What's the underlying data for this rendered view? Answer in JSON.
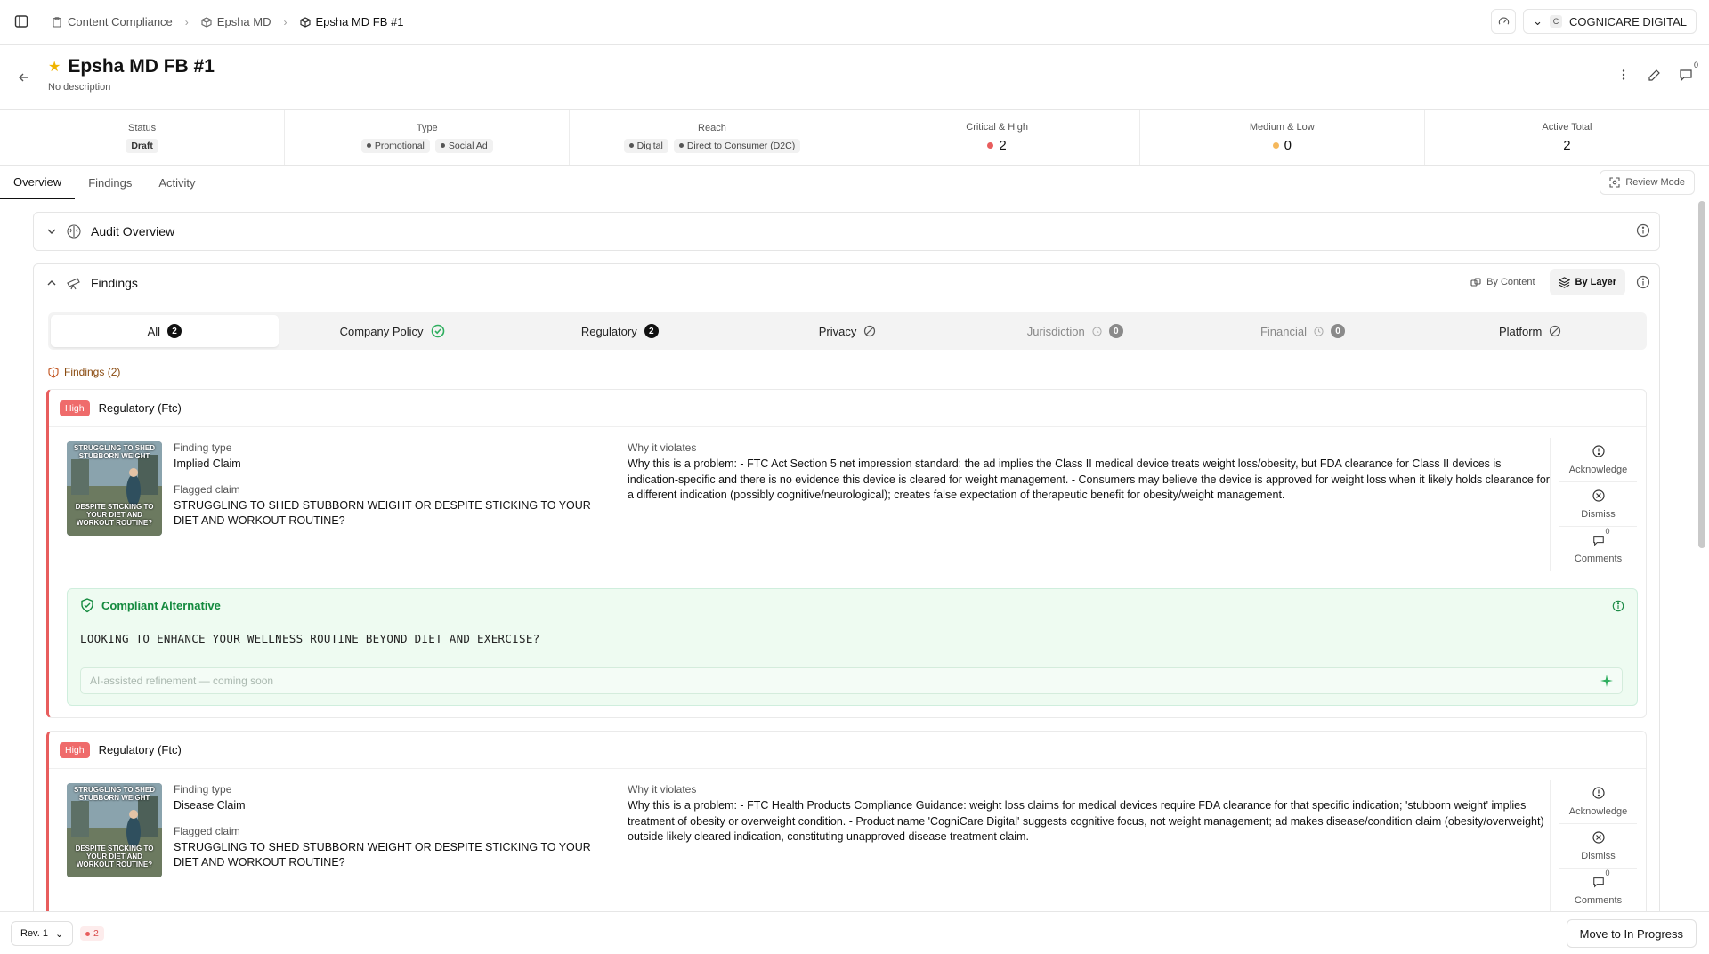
{
  "breadcrumbs": [
    "Content Compliance",
    "Epsha MD",
    "Epsha MD FB #1"
  ],
  "org": {
    "initial": "C",
    "name": "COGNICARE DIGITAL"
  },
  "header": {
    "title": "Epsha MD FB #1",
    "description": "No description",
    "comment_count": "0"
  },
  "stats": {
    "status": {
      "label": "Status",
      "value": "Draft"
    },
    "type": {
      "label": "Type",
      "values": [
        "Promotional",
        "Social Ad"
      ]
    },
    "reach": {
      "label": "Reach",
      "values": [
        "Digital",
        "Direct to Consumer (D2C)"
      ]
    },
    "critical_high": {
      "label": "Critical & High",
      "value": "2"
    },
    "medium_low": {
      "label": "Medium & Low",
      "value": "0"
    },
    "active_total": {
      "label": "Active Total",
      "value": "2"
    }
  },
  "tabs": [
    "Overview",
    "Findings",
    "Activity"
  ],
  "review_mode": "Review Mode",
  "audit_overview": {
    "title": "Audit Overview"
  },
  "findings_panel": {
    "title": "Findings",
    "by_content": "By Content",
    "by_layer": "By Layer",
    "layers": [
      {
        "label": "All",
        "count": "2"
      },
      {
        "label": "Company Policy"
      },
      {
        "label": "Regulatory",
        "count": "2"
      },
      {
        "label": "Privacy"
      },
      {
        "label": "Jurisdiction",
        "count": "0"
      },
      {
        "label": "Financial",
        "count": "0"
      },
      {
        "label": "Platform"
      }
    ],
    "findings_count": "Findings (2)"
  },
  "thumbnail": {
    "line1": "STRUGGLING TO SHED STUBBORN WEIGHT",
    "line2": "DESPITE STICKING TO YOUR DIET AND WORKOUT ROUTINE?"
  },
  "findings": [
    {
      "severity": "High",
      "category": "Regulatory (Ftc)",
      "finding_type_label": "Finding type",
      "finding_type": "Implied Claim",
      "flagged_label": "Flagged claim",
      "flagged": "STRUGGLING TO SHED STUBBORN WEIGHT OR DESPITE STICKING TO YOUR DIET AND WORKOUT ROUTINE?",
      "why_label": "Why it violates",
      "why": "Why this is a problem: - FTC Act Section 5 net impression standard: the ad implies the Class II medical device treats weight loss/obesity, but FDA clearance for Class II devices is indication-specific and there is no evidence this device is cleared for weight management. - Consumers may believe the device is approved for weight loss when it likely holds clearance for a different indication (possibly cognitive/neurological); creates false expectation of therapeutic benefit for obesity/weight management.",
      "actions": {
        "acknowledge": "Acknowledge",
        "dismiss": "Dismiss",
        "comments": "Comments",
        "comment_count": "0"
      },
      "alternative": {
        "title": "Compliant Alternative",
        "text": "LOOKING TO ENHANCE YOUR WELLNESS ROUTINE BEYOND DIET AND EXERCISE?",
        "placeholder": "AI-assisted refinement — coming soon"
      }
    },
    {
      "severity": "High",
      "category": "Regulatory (Ftc)",
      "finding_type_label": "Finding type",
      "finding_type": "Disease Claim",
      "flagged_label": "Flagged claim",
      "flagged": "STRUGGLING TO SHED STUBBORN WEIGHT OR DESPITE STICKING TO YOUR DIET AND WORKOUT ROUTINE?",
      "why_label": "Why it violates",
      "why": "Why this is a problem: - FTC Health Products Compliance Guidance: weight loss claims for medical devices require FDA clearance for that specific indication; 'stubborn weight' implies treatment of obesity or overweight condition. - Product name 'CogniCare Digital' suggests cognitive focus, not weight management; ad makes disease/condition claim (obesity/overweight) outside likely cleared indication, constituting unapproved disease treatment claim.",
      "actions": {
        "acknowledge": "Acknowledge",
        "dismiss": "Dismiss",
        "comments": "Comments",
        "comment_count": "0"
      }
    }
  ],
  "footer": {
    "revision": "Rev. 1",
    "issue_count": "2",
    "move_button": "Move to In Progress"
  }
}
